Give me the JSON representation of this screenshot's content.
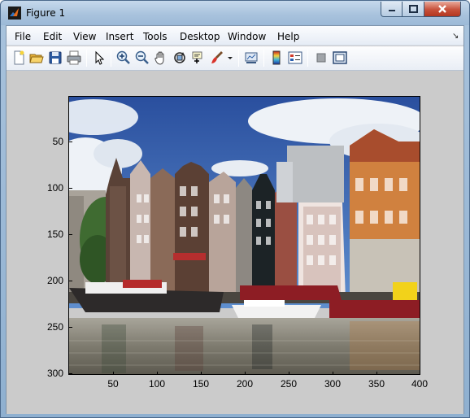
{
  "window": {
    "title": "Figure 1",
    "controls": {
      "minimize": "minimize",
      "maximize": "maximize",
      "close": "close"
    }
  },
  "menubar": {
    "items": [
      "File",
      "Edit",
      "View",
      "Insert",
      "Tools",
      "Desktop",
      "Window",
      "Help"
    ],
    "overflow_glyph": "↘"
  },
  "toolbar": {
    "icons": [
      "new-figure",
      "open-file",
      "save",
      "print",
      "edit-plot-arrow",
      "zoom-in",
      "zoom-out",
      "pan",
      "rotate-3d",
      "data-cursor",
      "brush",
      "brush-dropdown",
      "link-plot",
      "insert-colorbar",
      "insert-legend",
      "hide-plot-tools",
      "show-plot-tools"
    ]
  },
  "axes": {
    "y_ticks": [
      "50",
      "100",
      "150",
      "200",
      "250",
      "300"
    ],
    "x_ticks": [
      "50",
      "100",
      "150",
      "200",
      "250",
      "300",
      "350",
      "400"
    ],
    "image_content": "Canal houses photograph"
  }
}
